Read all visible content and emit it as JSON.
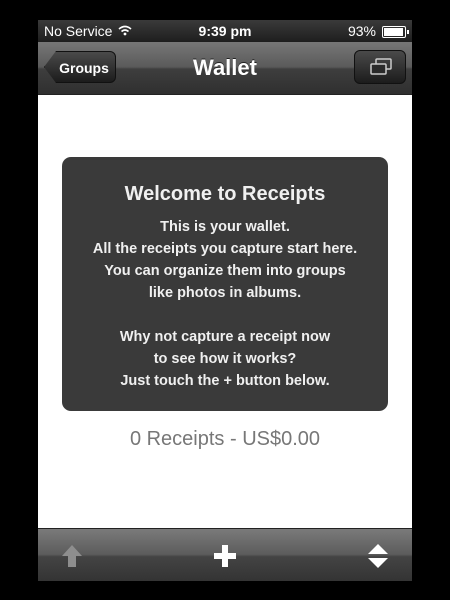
{
  "status_bar": {
    "carrier": "No Service",
    "time": "9:39 pm",
    "battery": "93%",
    "battery_level": 0.93,
    "icons": [
      "wifi-icon",
      "battery-icon"
    ]
  },
  "nav": {
    "back_label": "Groups",
    "title": "Wallet",
    "right_icon": "switch-icon"
  },
  "welcome": {
    "title": "Welcome to Receipts",
    "lines": [
      "This is your wallet.",
      "All the receipts you capture start here.",
      "You can organize them into groups",
      "like photos in albums.",
      "Why not capture a receipt now",
      "to see how it works?",
      "Just touch the + button below."
    ]
  },
  "summary": "0 Receipts - US$0.00",
  "toolbar": {
    "items": [
      "up-arrow-icon",
      "plus-icon",
      "sort-icon"
    ]
  }
}
